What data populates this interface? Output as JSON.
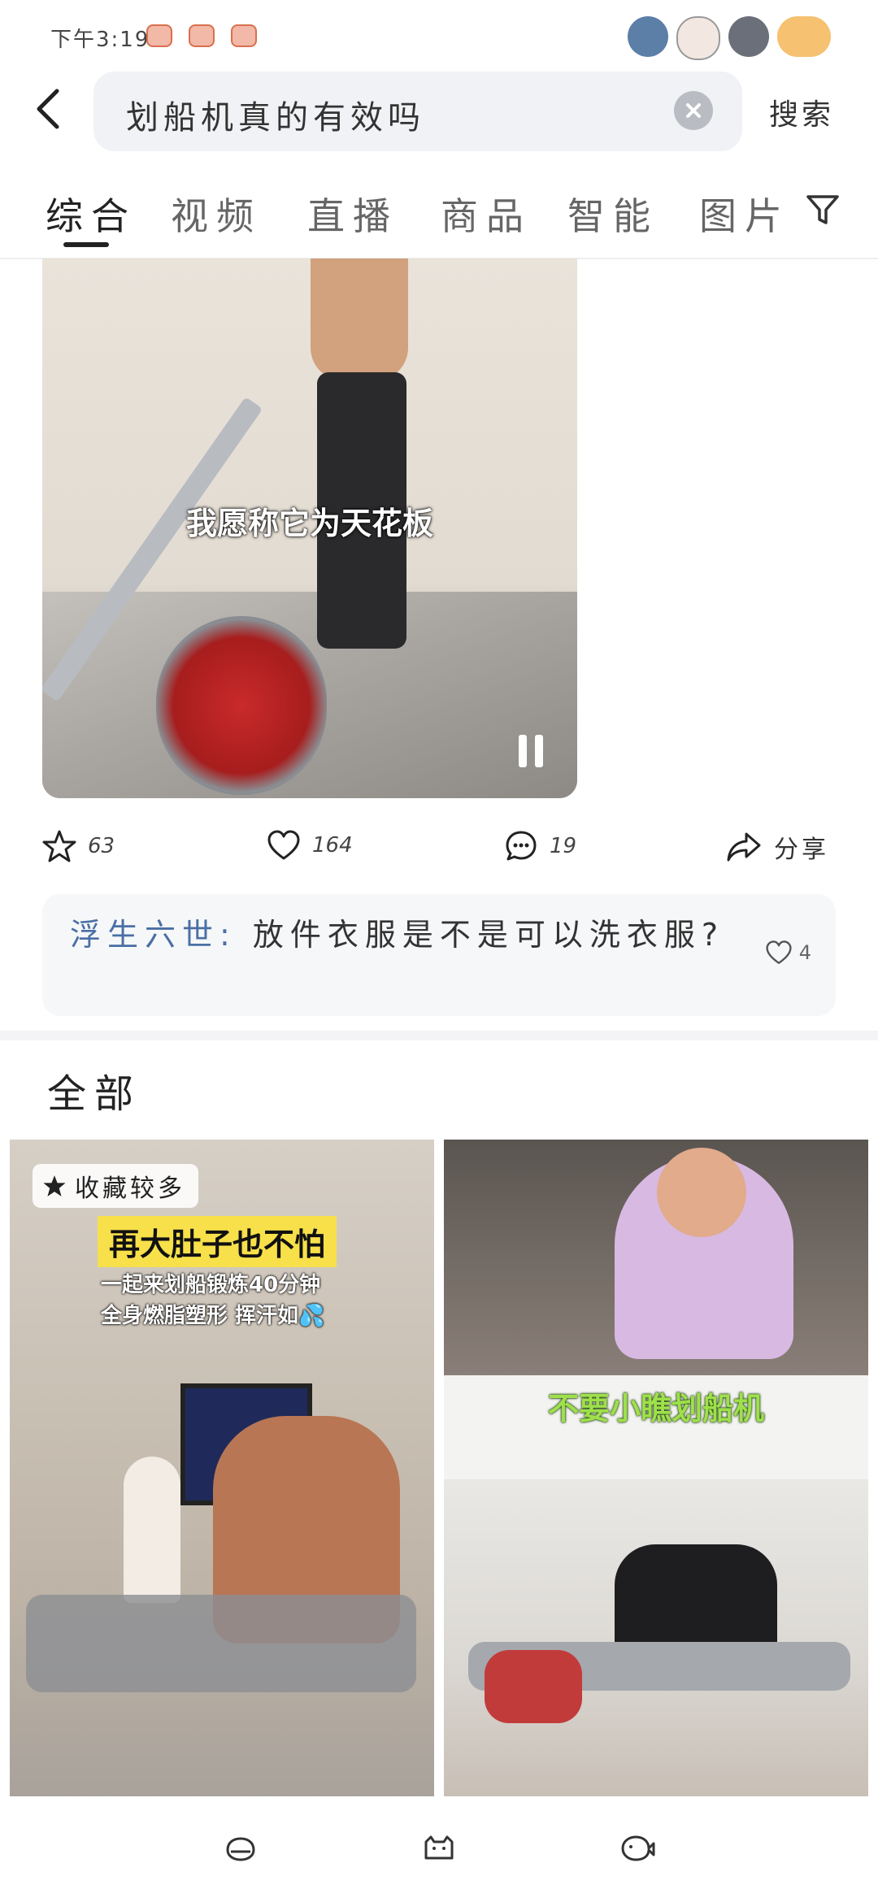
{
  "status_bar": {
    "time": "下午3:19"
  },
  "search": {
    "query": "划船机真的有效吗",
    "submit_label": "搜索"
  },
  "tabs": [
    {
      "label": "综合",
      "active": true
    },
    {
      "label": "视频"
    },
    {
      "label": "直播"
    },
    {
      "label": "商品"
    },
    {
      "label": "智能"
    },
    {
      "label": "图片"
    }
  ],
  "video": {
    "subtitle": "我愿称它为天花板",
    "stats": {
      "collect": "63",
      "like": "164",
      "comment": "19",
      "share_label": "分享"
    }
  },
  "comment": {
    "author": "浮生六世:",
    "text": "放件衣服是不是可以洗衣服?",
    "likes": "4"
  },
  "section": {
    "title": "全部"
  },
  "grid": [
    {
      "badge": "收藏较多",
      "title": "再大肚子也不怕",
      "line1": "一起来划船锻炼40分钟",
      "line2": "全身燃脂塑形 挥汗如💦"
    },
    {
      "caption": "不要小瞧划船机"
    }
  ],
  "colors": {
    "accent": "#222222",
    "comment_author": "#4a6fa5",
    "title_highlight": "#f7e04a",
    "caption_green": "#9ee04a"
  }
}
